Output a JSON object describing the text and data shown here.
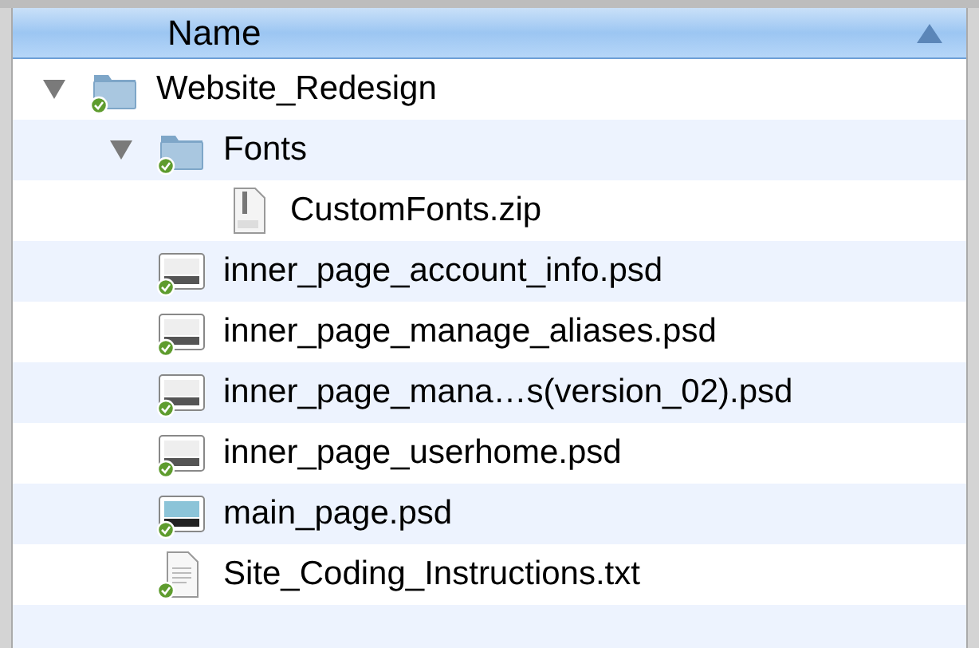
{
  "header": {
    "label": "Name",
    "sort_ascending": true
  },
  "tree": [
    {
      "name": "Website_Redesign",
      "kind": "folder",
      "expanded": true,
      "synced": true,
      "children": [
        {
          "name": "Fonts",
          "kind": "folder",
          "expanded": true,
          "synced": true,
          "children": [
            {
              "name": "CustomFonts.zip",
              "kind": "zip",
              "synced": false
            }
          ]
        },
        {
          "name": "inner_page_account_info.psd",
          "kind": "psd",
          "synced": true
        },
        {
          "name": "inner_page_manage_aliases.psd",
          "kind": "psd",
          "synced": true
        },
        {
          "name": "inner_page_mana…s(version_02).psd",
          "kind": "psd",
          "synced": true
        },
        {
          "name": "inner_page_userhome.psd",
          "kind": "psd",
          "synced": true
        },
        {
          "name": "main_page.psd",
          "kind": "psd-dark",
          "synced": true
        },
        {
          "name": "Site_Coding_Instructions.txt",
          "kind": "txt",
          "synced": true
        }
      ]
    }
  ]
}
